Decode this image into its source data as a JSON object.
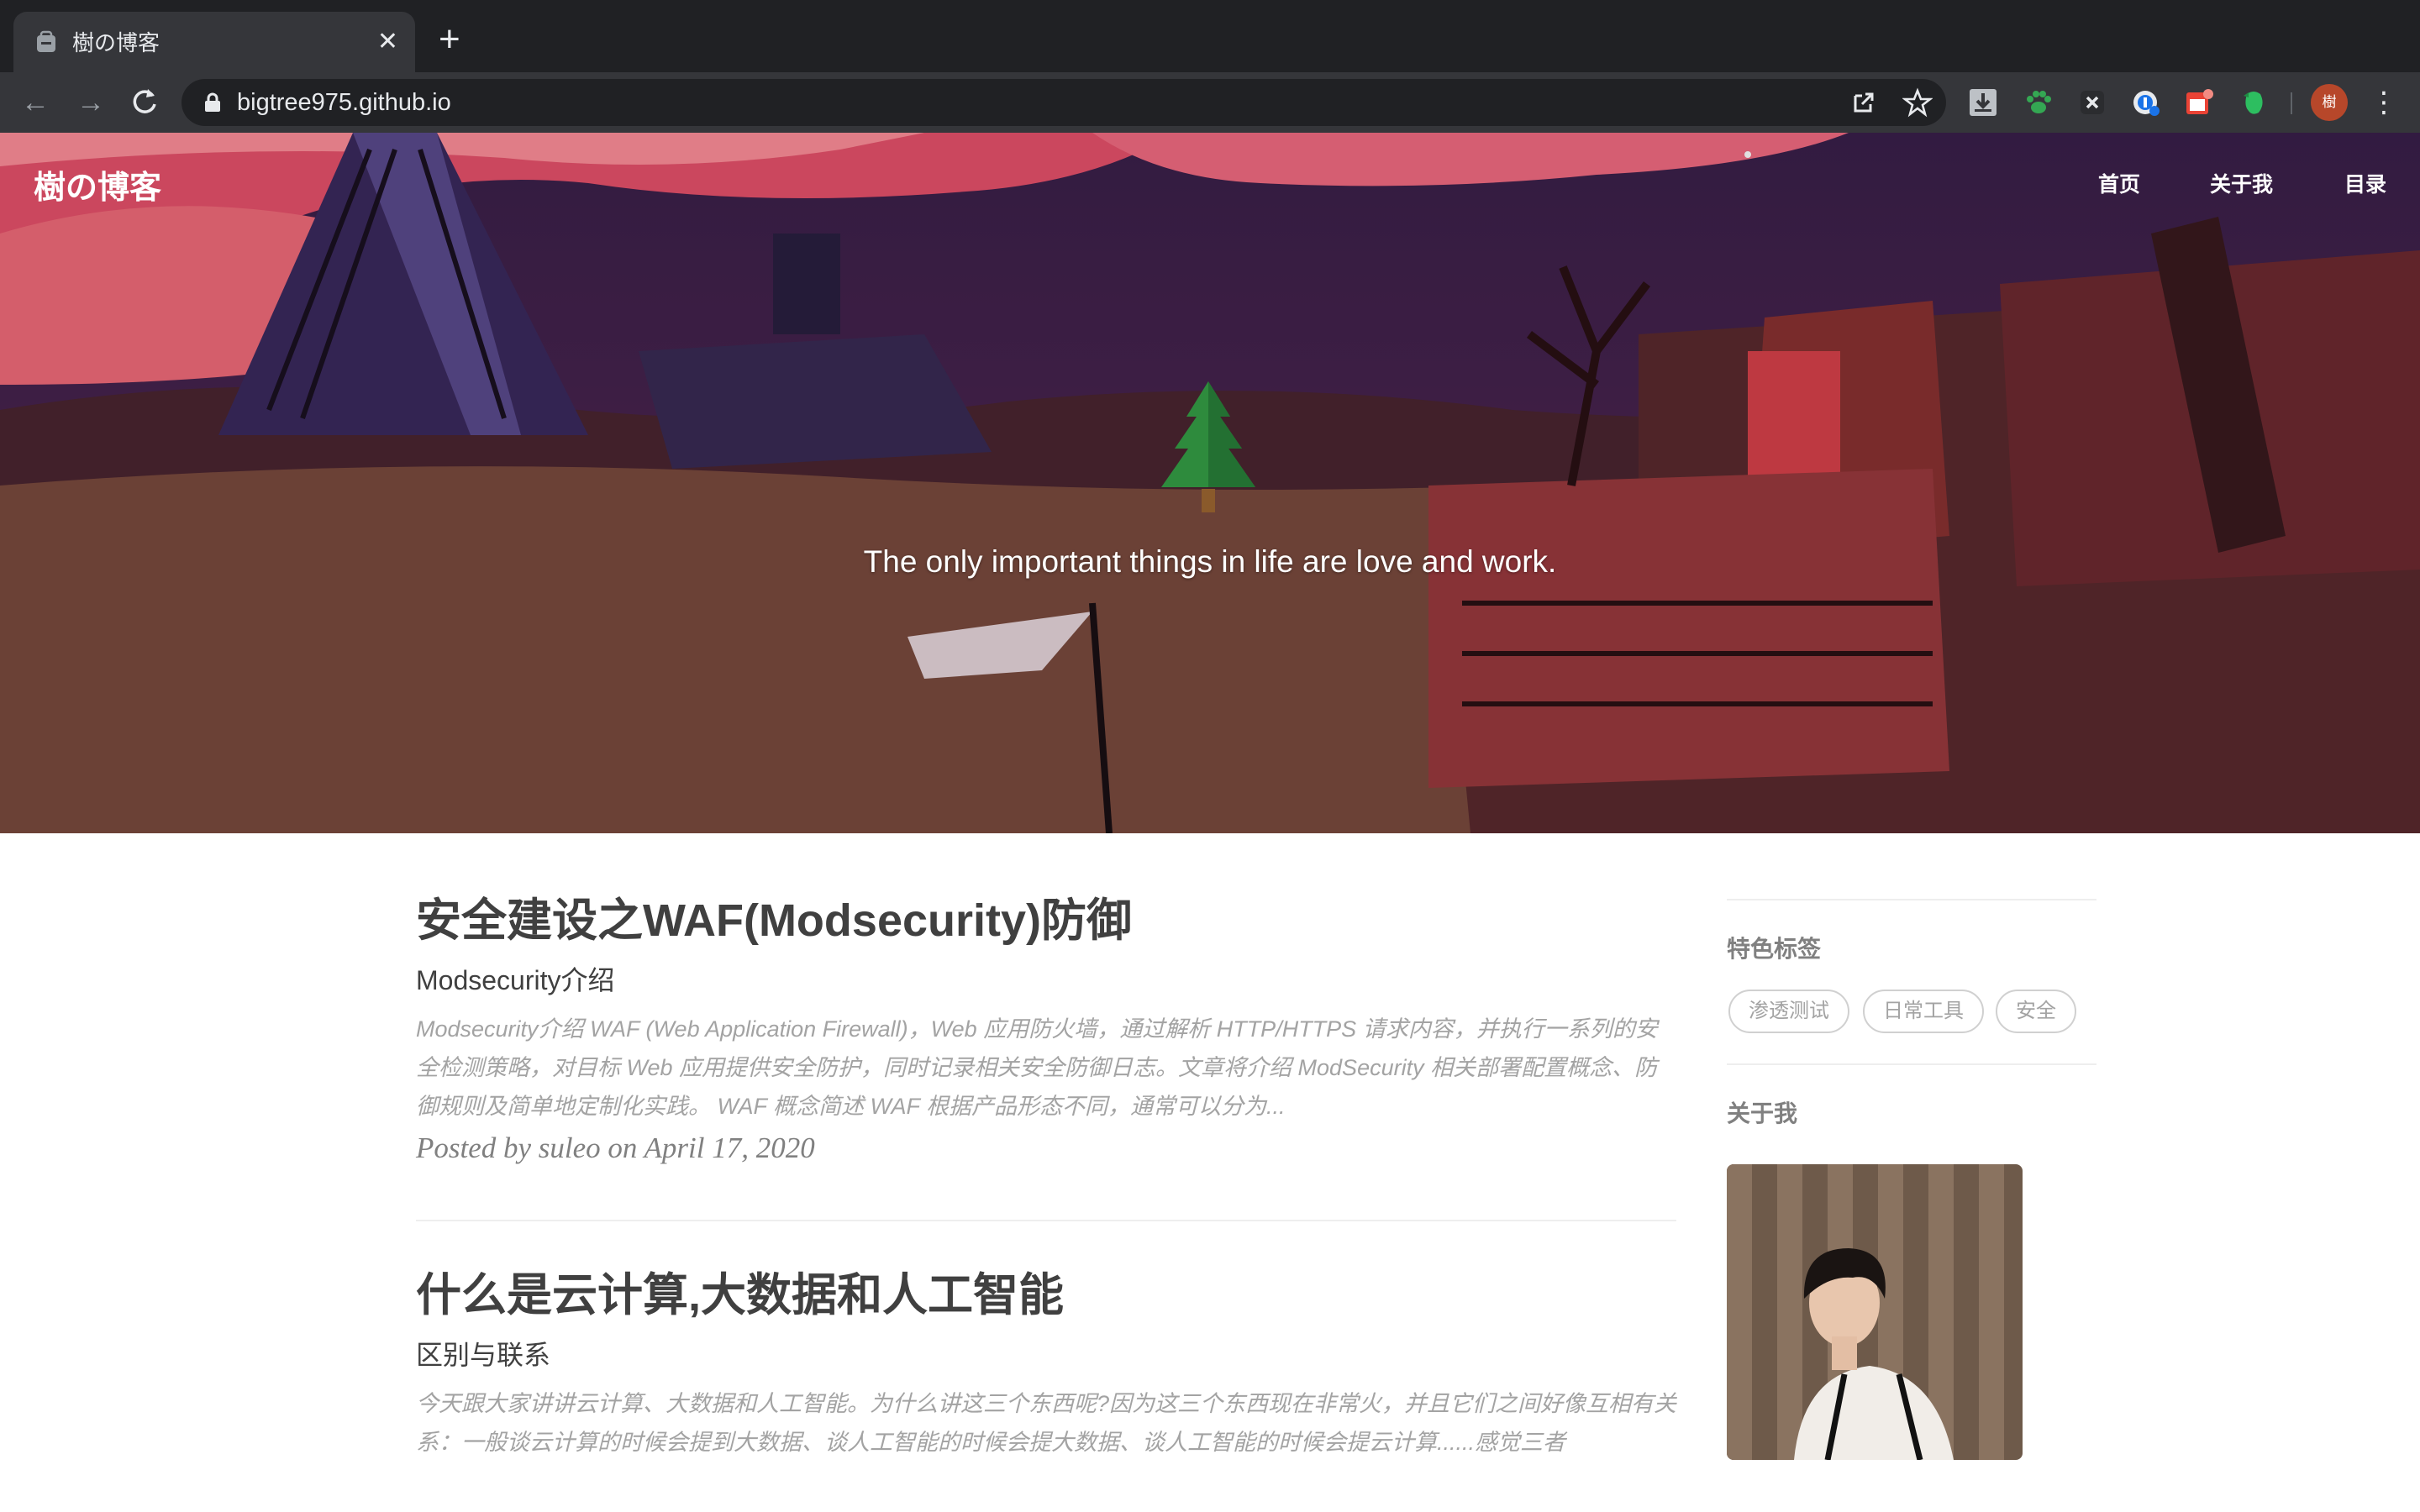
{
  "browser": {
    "tab_title": "樹の博客",
    "url": "bigtree975.github.io",
    "profile_initial": "樹"
  },
  "site": {
    "title": "樹の博客",
    "nav": [
      "首页",
      "关于我",
      "目录"
    ],
    "quote": "The only important things in life are love and work."
  },
  "posts": [
    {
      "title": "安全建设之WAF(Modsecurity)防御",
      "subtitle": "Modsecurity介绍",
      "excerpt": "Modsecurity介绍 WAF (Web Application Firewall)，Web 应用防火墙，通过解析 HTTP/HTTPS 请求内容，并执行一系列的安全检测策略，对目标 Web 应用提供安全防护，同时记录相关安全防御日志。文章将介绍 ModSecurity 相关部署配置概念、防御规则及简单地定制化实践。 WAF 概念简述 WAF 根据产品形态不同，通常可以分为...",
      "meta": "Posted by suleo on April 17, 2020"
    },
    {
      "title": "什么是云计算,大数据和人工智能",
      "subtitle": "区别与联系",
      "excerpt": "今天跟大家讲讲云计算、大数据和人工智能。为什么讲这三个东西呢?因为这三个东西现在非常火，并且它们之间好像互相有关系：一般谈云计算的时候会提到大数据、谈人工智能的时候会提大数据、谈人工智能的时候会提云计算......感觉三者"
    }
  ],
  "sidebar": {
    "tags_heading": "特色标签",
    "tags": [
      "渗透测试",
      "日常工具",
      "安全"
    ],
    "about_heading": "关于我"
  }
}
